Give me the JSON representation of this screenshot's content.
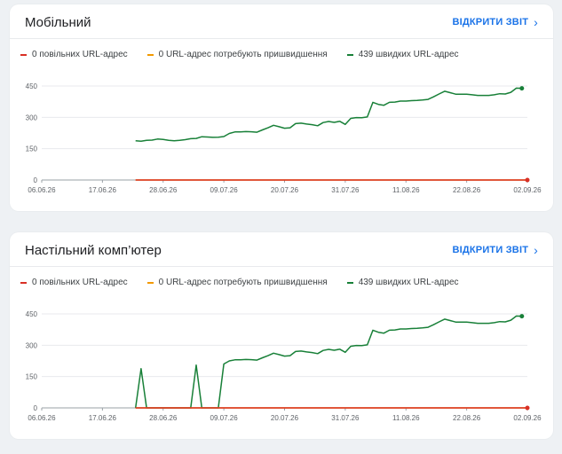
{
  "colors": {
    "slow": "#d93025",
    "needs_improvement": "#f29900",
    "fast": "#188038",
    "link": "#1a73e8"
  },
  "cards": [
    {
      "title": "Мобільний",
      "open_report_label": "ВІДКРИТИ ЗВІТ",
      "open_report_icon": "chevron-right-icon",
      "legend": [
        "0 повільних URL-адрес",
        "0 URL-адрес потребують пришвидшення",
        "439 швидких URL-адрес"
      ]
    },
    {
      "title": "Настільний комп’ютер",
      "open_report_label": "ВІДКРИТИ ЗВІТ",
      "open_report_icon": "chevron-right-icon",
      "legend": [
        "0 повільних URL-адрес",
        "0 URL-адрес потребують пришвидшення",
        "439 швидких URL-адрес"
      ]
    }
  ],
  "chart_data": [
    {
      "type": "line",
      "title": "Мобільний",
      "x_tick_labels": [
        "06.06.26",
        "17.06.26",
        "28.06.26",
        "09.07.26",
        "20.07.26",
        "31.07.26",
        "11.08.26",
        "22.08.26",
        "02.09.26"
      ],
      "y_ticks": [
        0,
        150,
        300,
        450
      ],
      "ylim": [
        0,
        450
      ],
      "x_days_range": [
        0,
        88
      ],
      "series": [
        {
          "name": "0 повільних URL-адрес",
          "points": [
            [
              17,
              0
            ],
            [
              88,
              0
            ]
          ]
        },
        {
          "name": "0 URL-адрес потребують пришвидшення",
          "points": [
            [
              17,
              0
            ],
            [
              88,
              0
            ]
          ]
        },
        {
          "name": "439 швидких URL-адрес",
          "points": [
            [
              17,
              188
            ],
            [
              18,
              186
            ],
            [
              19,
              190
            ],
            [
              20,
              191
            ],
            [
              21,
              196
            ],
            [
              22,
              194
            ],
            [
              23,
              190
            ],
            [
              24,
              188
            ],
            [
              25,
              190
            ],
            [
              26,
              193
            ],
            [
              27,
              198
            ],
            [
              28,
              199
            ],
            [
              29,
              207
            ],
            [
              30,
              206
            ],
            [
              31,
              204
            ],
            [
              32,
              205
            ],
            [
              33,
              208
            ],
            [
              34,
              223
            ],
            [
              35,
              230
            ],
            [
              36,
              230
            ],
            [
              37,
              232
            ],
            [
              38,
              231
            ],
            [
              39,
              229
            ],
            [
              40,
              240
            ],
            [
              41,
              250
            ],
            [
              42,
              262
            ],
            [
              43,
              255
            ],
            [
              44,
              248
            ],
            [
              45,
              250
            ],
            [
              46,
              270
            ],
            [
              47,
              272
            ],
            [
              48,
              268
            ],
            [
              49,
              265
            ],
            [
              50,
              260
            ],
            [
              51,
              275
            ],
            [
              52,
              280
            ],
            [
              53,
              276
            ],
            [
              54,
              281
            ],
            [
              55,
              266
            ],
            [
              56,
              295
            ],
            [
              57,
              299
            ],
            [
              58,
              298
            ],
            [
              59,
              302
            ],
            [
              60,
              372
            ],
            [
              61,
              362
            ],
            [
              62,
              358
            ],
            [
              63,
              372
            ],
            [
              64,
              373
            ],
            [
              65,
              378
            ],
            [
              66,
              378
            ],
            [
              67,
              380
            ],
            [
              68,
              381
            ],
            [
              69,
              383
            ],
            [
              70,
              386
            ],
            [
              71,
              398
            ],
            [
              72,
              412
            ],
            [
              73,
              425
            ],
            [
              74,
              418
            ],
            [
              75,
              411
            ],
            [
              76,
              411
            ],
            [
              77,
              411
            ],
            [
              78,
              408
            ],
            [
              79,
              405
            ],
            [
              80,
              405
            ],
            [
              81,
              405
            ],
            [
              82,
              408
            ],
            [
              83,
              413
            ],
            [
              84,
              412
            ],
            [
              85,
              420
            ],
            [
              86,
              440
            ],
            [
              87,
              439
            ]
          ]
        }
      ]
    },
    {
      "type": "line",
      "title": "Настільний комп’ютер",
      "x_tick_labels": [
        "06.06.26",
        "17.06.26",
        "28.06.26",
        "09.07.26",
        "20.07.26",
        "31.07.26",
        "11.08.26",
        "22.08.26",
        "02.09.26"
      ],
      "y_ticks": [
        0,
        150,
        300,
        450
      ],
      "ylim": [
        0,
        450
      ],
      "x_days_range": [
        0,
        88
      ],
      "series": [
        {
          "name": "0 повільних URL-адрес",
          "points": [
            [
              17,
              0
            ],
            [
              88,
              0
            ]
          ]
        },
        {
          "name": "0 URL-адрес потребують пришвидшення",
          "points": [
            [
              17,
              0
            ],
            [
              88,
              0
            ]
          ]
        },
        {
          "name": "439 швидких URL-адрес",
          "points": [
            [
              17,
              0
            ],
            [
              18,
              188
            ],
            [
              19,
              0
            ],
            [
              20,
              0
            ],
            [
              21,
              0
            ],
            [
              22,
              0
            ],
            [
              23,
              0
            ],
            [
              24,
              0
            ],
            [
              25,
              0
            ],
            [
              26,
              0
            ],
            [
              27,
              0
            ],
            [
              28,
              205
            ],
            [
              29,
              0
            ],
            [
              30,
              0
            ],
            [
              31,
              0
            ],
            [
              32,
              0
            ],
            [
              33,
              210
            ],
            [
              34,
              225
            ],
            [
              35,
              230
            ],
            [
              36,
              230
            ],
            [
              37,
              232
            ],
            [
              38,
              231
            ],
            [
              39,
              229
            ],
            [
              40,
              240
            ],
            [
              41,
              250
            ],
            [
              42,
              262
            ],
            [
              43,
              255
            ],
            [
              44,
              248
            ],
            [
              45,
              250
            ],
            [
              46,
              270
            ],
            [
              47,
              272
            ],
            [
              48,
              268
            ],
            [
              49,
              265
            ],
            [
              50,
              260
            ],
            [
              51,
              275
            ],
            [
              52,
              280
            ],
            [
              53,
              276
            ],
            [
              54,
              281
            ],
            [
              55,
              266
            ],
            [
              56,
              295
            ],
            [
              57,
              299
            ],
            [
              58,
              298
            ],
            [
              59,
              302
            ],
            [
              60,
              372
            ],
            [
              61,
              362
            ],
            [
              62,
              358
            ],
            [
              63,
              372
            ],
            [
              64,
              373
            ],
            [
              65,
              378
            ],
            [
              66,
              378
            ],
            [
              67,
              380
            ],
            [
              68,
              381
            ],
            [
              69,
              383
            ],
            [
              70,
              386
            ],
            [
              71,
              398
            ],
            [
              72,
              412
            ],
            [
              73,
              425
            ],
            [
              74,
              418
            ],
            [
              75,
              411
            ],
            [
              76,
              411
            ],
            [
              77,
              411
            ],
            [
              78,
              408
            ],
            [
              79,
              405
            ],
            [
              80,
              405
            ],
            [
              81,
              405
            ],
            [
              82,
              408
            ],
            [
              83,
              413
            ],
            [
              84,
              412
            ],
            [
              85,
              420
            ],
            [
              86,
              440
            ],
            [
              87,
              439
            ]
          ]
        }
      ]
    }
  ]
}
